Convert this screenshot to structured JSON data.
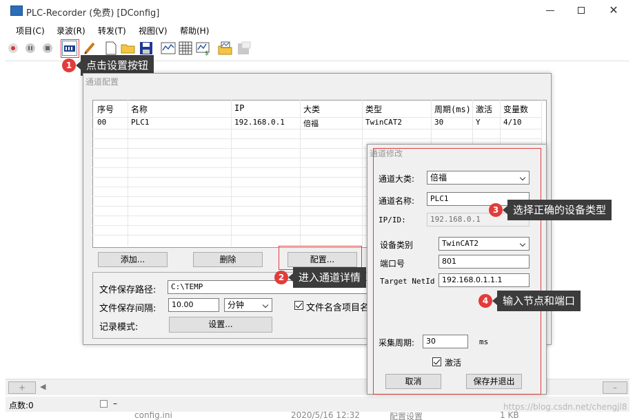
{
  "window": {
    "title": "PLC-Recorder (免费) [DConfig]"
  },
  "menu": [
    "项目(C)",
    "录波(R)",
    "转发(T)",
    "视图(V)",
    "帮助(H)"
  ],
  "annotations": {
    "a1": {
      "num": "1",
      "text": "点击设置按钮"
    },
    "a2": {
      "num": "2",
      "text": "进入通道详情"
    },
    "a3": {
      "num": "3",
      "text": "选择正确的设备类型"
    },
    "a4": {
      "num": "4",
      "text": "输入节点和端口"
    }
  },
  "channel_config": {
    "title": "通道配置",
    "columns": [
      "序号",
      "名称",
      "IP",
      "大类",
      "类型",
      "周期(ms)",
      "激活",
      "变量数"
    ],
    "rows": [
      [
        "00",
        "PLC1",
        "192.168.0.1",
        "倍福",
        "TwinCAT2",
        "30",
        "Y",
        "4/10"
      ]
    ],
    "buttons": {
      "add": "添加...",
      "delete": "删除",
      "configure": "配置..."
    },
    "save_path_label": "文件保存路径:",
    "save_path_value": "C:\\TEMP",
    "save_interval_label": "文件保存间隔:",
    "save_interval_value": "10.00",
    "save_interval_unit": "分钟",
    "filename_checkbox_label": "文件名含项目名称",
    "record_mode_label": "记录模式:",
    "record_mode_button": "设置..."
  },
  "channel_edit": {
    "title": "通道修改",
    "category_label": "通道大类:",
    "category_value": "倍福",
    "name_label": "通道名称:",
    "name_value": "PLC1",
    "ip_label": "IP/ID:",
    "ip_value": "192.168.0.1",
    "device_type_label": "设备类别",
    "device_type_value": "TwinCAT2",
    "port_label": "端口号",
    "port_value": "801",
    "netid_label": "Target NetId",
    "netid_value": "192.168.0.1.1.1",
    "period_label": "采集周期:",
    "period_value": "30",
    "period_unit": "ms",
    "active_label": "激活",
    "cancel": "取消",
    "save_exit": "保存并退出"
  },
  "status": {
    "points": "点数:0",
    "dash": "–"
  },
  "background": {
    "file_name": "config.ini",
    "file_date": "2020/5/16 12:32",
    "file_type": "配置设置",
    "file_size": "1 KB",
    "watermark": "https://blog.csdn.net/chengjl8"
  }
}
